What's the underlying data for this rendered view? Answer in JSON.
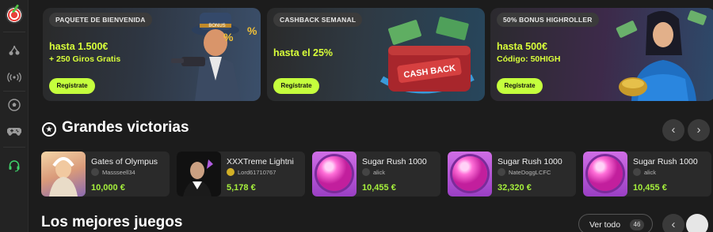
{
  "sidebar": {
    "icons": [
      "dartboard-logo",
      "cherry-icon",
      "live-broadcast-icon",
      "soccer-ball-icon",
      "gamepad-icon",
      "headset-icon"
    ]
  },
  "banners": [
    {
      "tag": "PAQUETE DE BIENVENIDA",
      "line1": "hasta 1.500€",
      "line2": "+ 250 Giros Gratis",
      "button": "Regístrate"
    },
    {
      "tag": "CASHBACK SEMANAL",
      "line1": "hasta el 25%",
      "line2": "",
      "button": "Regístrate",
      "art_text": "CASH BACK"
    },
    {
      "tag": "50% BONUS HIGHROLLER",
      "line1": "hasta 500€",
      "line2": "Código: 50HIGH",
      "button": "Regístrate"
    }
  ],
  "wins_section": {
    "title": "Grandes victorias",
    "prev": "‹",
    "next": "›",
    "cards": [
      {
        "game": "Gates of Olympus",
        "user": "Massseell34",
        "amount": "10,000 €"
      },
      {
        "game": "XXXTreme Lightni",
        "user": "Lord61710767",
        "amount": "5,178 €"
      },
      {
        "game": "Sugar Rush 1000",
        "user": "alick",
        "amount": "10,455 €"
      },
      {
        "game": "Sugar Rush 1000",
        "user": "NateDoggLCFC",
        "amount": "32,320 €"
      },
      {
        "game": "Sugar Rush 1000",
        "user": "alick",
        "amount": "10,455 €"
      }
    ]
  },
  "games_section": {
    "title": "Los mejores juegos",
    "view_all": "Ver todo",
    "count": "46",
    "prev": "‹"
  },
  "colors": {
    "accent": "#c5ff3d",
    "win_amount": "#a6f03c",
    "background": "#1c1c1c"
  }
}
